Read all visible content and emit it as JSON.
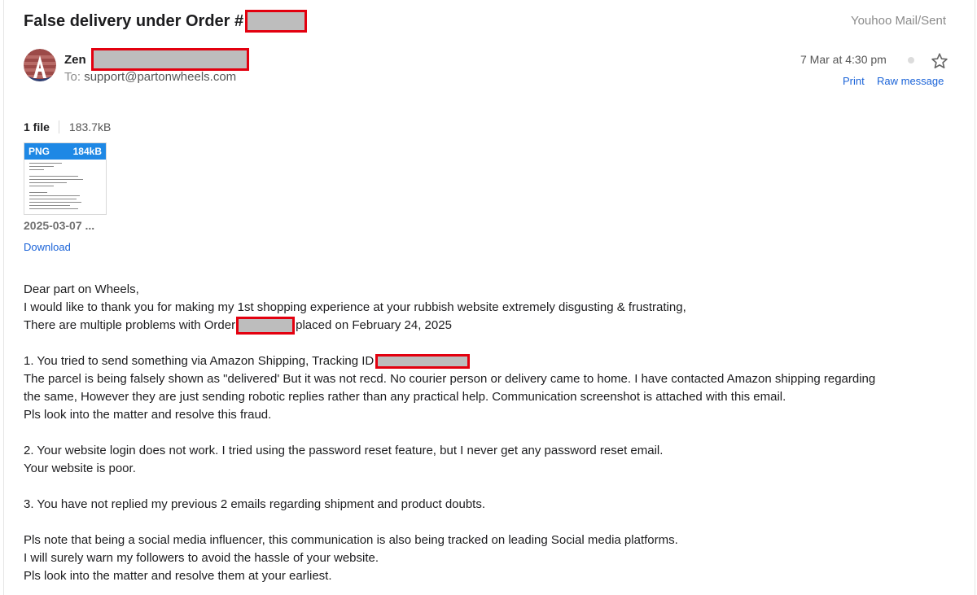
{
  "email": {
    "subject": "False delivery under Order #",
    "folder": "Youhoo Mail/Sent",
    "sender_name": "Zen",
    "to_label": "To:",
    "to_address": "support@partonwheels.com",
    "date": "7 Mar at 4:30 pm",
    "actions": {
      "print": "Print",
      "raw": "Raw message"
    }
  },
  "attachments": {
    "count_label": "1 file",
    "total_size": "183.7kB",
    "file": {
      "type": "PNG",
      "size": "184kB",
      "name": "2025-03-07 ...",
      "download": "Download"
    }
  },
  "body": {
    "greeting": "Dear part on Wheels,",
    "line1": "I would like to thank you for making my 1st shopping experience at your rubbish website extremely disgusting & frustrating,",
    "line2_a": "There are multiple problems with Order",
    "line2_b": "placed on February 24, 2025",
    "p1_a": "1. You tried to send something via Amazon Shipping, Tracking ID",
    "p1_l2": "The parcel is being falsely shown as \"delivered' But it was not recd. No courier person or delivery came to home. I have contacted Amazon shipping regarding",
    "p1_l3": "the same, However they are just sending robotic replies rather than any practical help. Communication screenshot is attached with this email.",
    "p1_l4": "Pls look into the matter and resolve this fraud.",
    "p2_l1": "2. Your website login does not work. I tried using the password reset feature, but I never get any password reset email.",
    "p2_l2": "Your website is poor.",
    "p3_l1": "3. You have not replied my previous 2 emails regarding shipment and product doubts.",
    "p4_l1": "Pls note that being a social media influencer, this communication is also being tracked on leading Social media platforms.",
    "p4_l2": "I will surely warn my followers to avoid the hassle of your website.",
    "p4_l3": "Pls look into the matter and resolve them at your earliest."
  },
  "colors": {
    "link": "#1a63d8",
    "redaction_border": "#e3000f",
    "redaction_fill": "#bdbdbd",
    "attachment_header": "#1e88e5"
  },
  "icons": {
    "avatar": "avatar-logo-icon",
    "star": "star-icon",
    "status_dot": "status-dot-icon"
  }
}
